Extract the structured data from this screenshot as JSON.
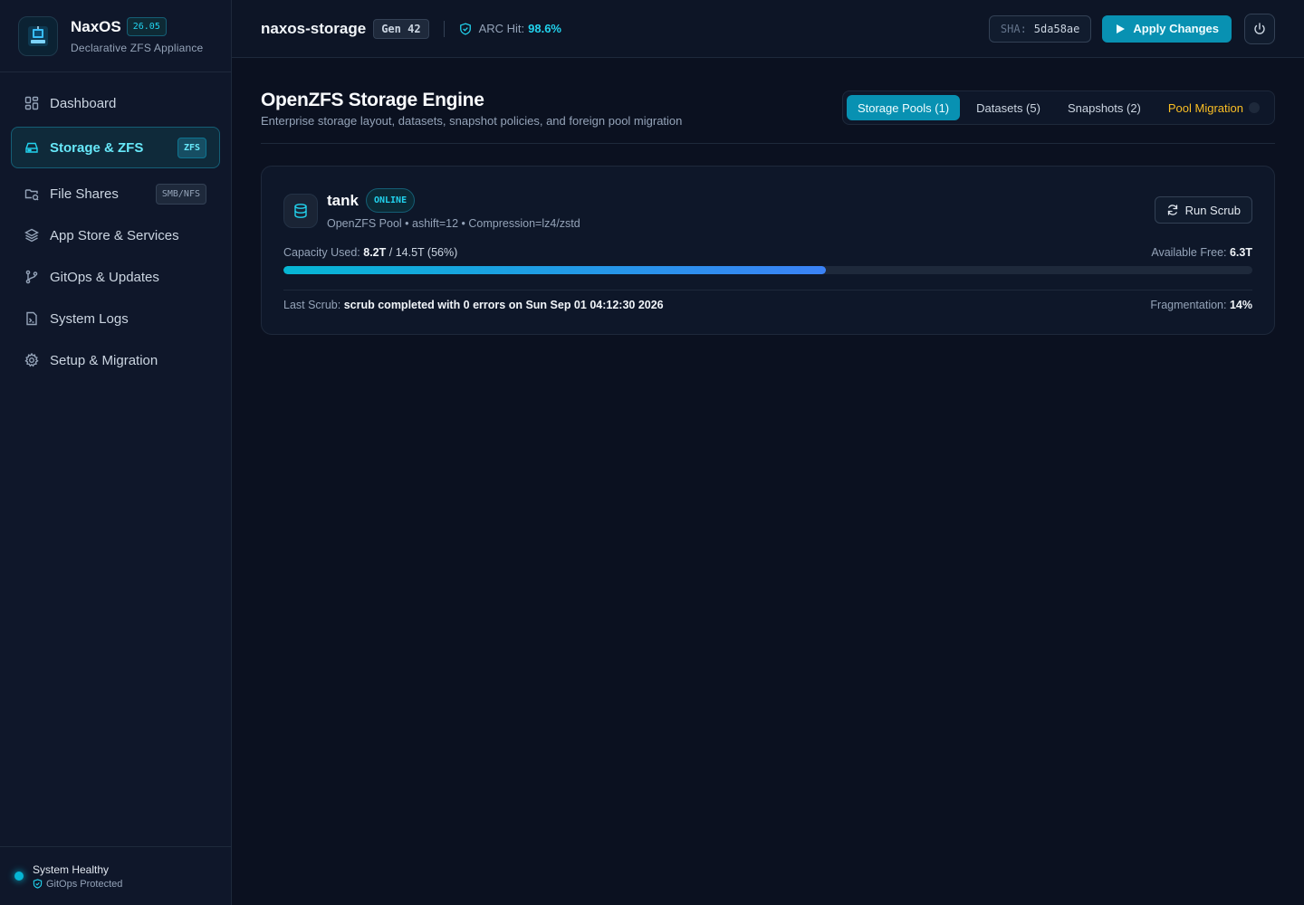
{
  "app": {
    "name": "NaxOS",
    "version": "26.05",
    "subtitle": "Declarative ZFS Appliance"
  },
  "sidebar": {
    "items": [
      {
        "label": "Dashboard",
        "icon": "grid-icon",
        "active": false
      },
      {
        "label": "Storage & ZFS",
        "icon": "drive-icon",
        "active": true,
        "badge": "ZFS"
      },
      {
        "label": "File Shares",
        "icon": "folder-share-icon",
        "active": false,
        "badge": "SMB/NFS"
      },
      {
        "label": "App Store & Services",
        "icon": "layers-icon",
        "active": false
      },
      {
        "label": "GitOps & Updates",
        "icon": "git-branch-icon",
        "active": false
      },
      {
        "label": "System Logs",
        "icon": "file-terminal-icon",
        "active": false
      },
      {
        "label": "Setup & Migration",
        "icon": "gear-icon",
        "active": false
      }
    ],
    "status": {
      "title": "System Healthy",
      "subtitle": "GitOps Protected"
    }
  },
  "topbar": {
    "hostname": "naxos-storage",
    "generation": "Gen 42",
    "arc_label": "ARC Hit:",
    "arc_value": "98.6%",
    "sha_label": "SHA:",
    "sha_value": "5da58ae",
    "apply_label": "Apply Changes"
  },
  "page": {
    "title": "OpenZFS Storage Engine",
    "subtitle": "Enterprise storage layout, datasets, snapshot policies, and foreign pool migration",
    "tabs": [
      {
        "label": "Storage Pools (1)",
        "active": true
      },
      {
        "label": "Datasets (5)",
        "active": false
      },
      {
        "label": "Snapshots (2)",
        "active": false
      },
      {
        "label": "Pool Migration",
        "active": false
      }
    ]
  },
  "pool": {
    "name": "tank",
    "status": "ONLINE",
    "meta": "OpenZFS Pool • ashift=12 • Compression=lz4/zstd",
    "scrub_button": "Run Scrub",
    "capacity_label": "Capacity Used:",
    "capacity_used": "8.2T",
    "capacity_total": "/ 14.5T (56%)",
    "capacity_fraction": 0.56,
    "free_label": "Available Free:",
    "free_value": "6.3T",
    "last_scrub_label": "Last Scrub:",
    "last_scrub_value": "scrub completed with 0 errors on Sun Sep 01 04:12:30 2026",
    "frag_label": "Fragmentation:",
    "frag_value": "14%"
  },
  "colors": {
    "accent": "#06b6d4",
    "accent_dark": "#0891b2",
    "warning": "#fbbf24",
    "background": "#0b1120"
  }
}
